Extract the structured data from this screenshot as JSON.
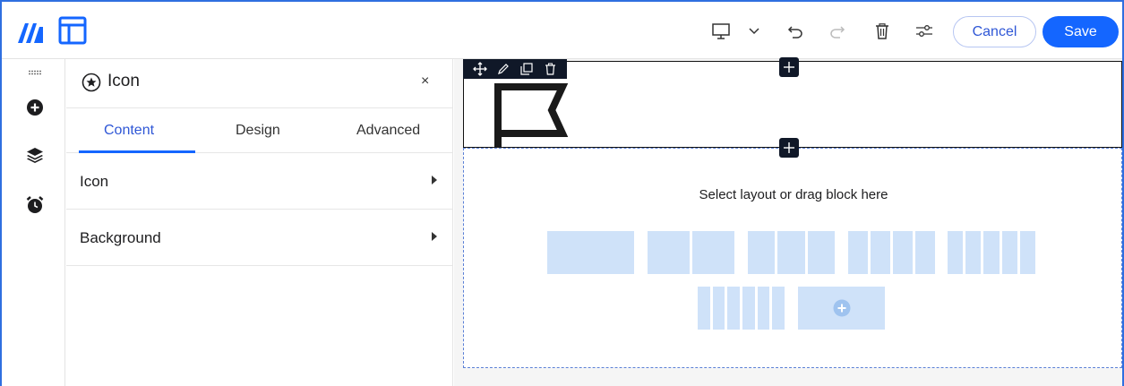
{
  "toolbar": {
    "cancel_label": "Cancel",
    "save_label": "Save",
    "icons": [
      "logo-icon",
      "layout-icon",
      "desktop-icon",
      "chevron-down-icon",
      "undo-icon",
      "redo-icon",
      "trash-icon",
      "settings-sliders-icon"
    ]
  },
  "rail": {
    "icons": [
      "drag-handle-icon",
      "add-icon",
      "layers-icon",
      "alarm-icon"
    ]
  },
  "panel": {
    "title": "Icon",
    "close": "×",
    "tabs": [
      {
        "label": "Content",
        "active": true
      },
      {
        "label": "Design",
        "active": false
      },
      {
        "label": "Advanced",
        "active": false
      }
    ],
    "rows": [
      {
        "label": "Icon"
      },
      {
        "label": "Background"
      }
    ]
  },
  "canvas": {
    "drop_text": "Select layout or drag block here",
    "block_icon": "flag-icon",
    "layout_options": [
      1,
      2,
      3,
      4,
      5,
      6
    ]
  },
  "colors": {
    "accent": "#1466ff",
    "frame": "#2f6fe0",
    "layout_tile": "#cfe2f9",
    "dark": "#101828"
  }
}
